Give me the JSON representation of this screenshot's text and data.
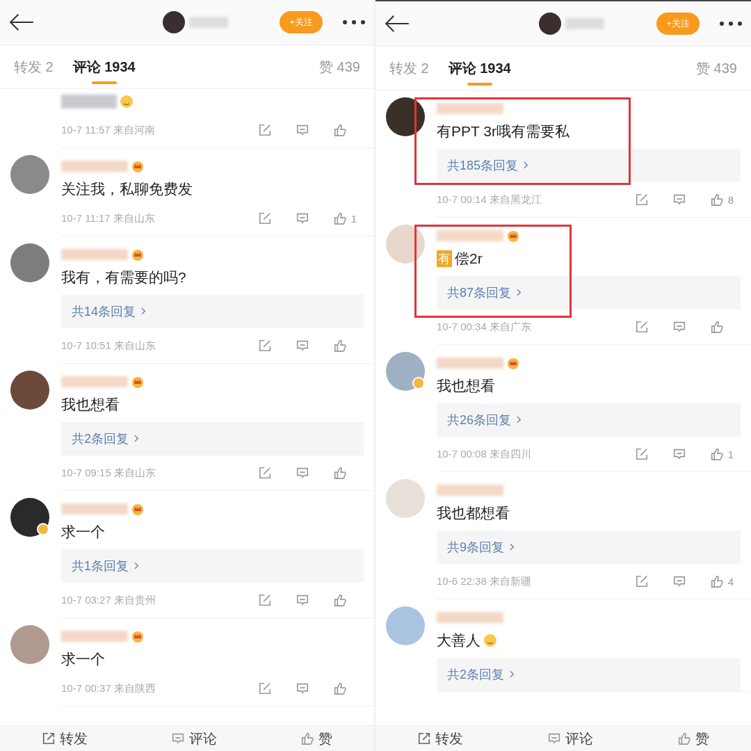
{
  "panels": [
    {
      "header": {
        "follow_label": "+关注"
      },
      "tabs": [
        {
          "label": "转发 2",
          "selected": false
        },
        {
          "label": "评论 1934",
          "selected": true
        }
      ],
      "likes_total": "赞 439",
      "comments": [
        {
          "kind": "partial",
          "emoji": true,
          "time": "10-7 11:57",
          "location": "来自河南"
        },
        {
          "kind": "full",
          "color": "#8a8a8a",
          "crown": true,
          "text": "关注我，私聊免费发",
          "time": "10-7 11:17",
          "location": "来自山东",
          "likes": "1"
        },
        {
          "kind": "full",
          "color": "#7d7d7d",
          "crown": true,
          "text": "我有，有需要的吗?",
          "replies": "共14条回复",
          "time": "10-7 10:51",
          "location": "来自山东"
        },
        {
          "kind": "full",
          "color": "#6b4a3a",
          "crown": true,
          "text": "我也想看",
          "replies": "共2条回复",
          "time": "10-7 09:15",
          "location": "来自山东"
        },
        {
          "kind": "full",
          "color": "#2a2a2a",
          "crown": true,
          "verified": true,
          "text": "求一个",
          "replies": "共1条回复",
          "time": "10-7 03:27",
          "location": "来自贵州"
        },
        {
          "kind": "full",
          "color": "#b09a90",
          "crown": true,
          "text": "求一个",
          "time": "10-7 00:37",
          "location": "来自陕西"
        }
      ],
      "bottom_bar": [
        {
          "kind": "repost",
          "label": "转发"
        },
        {
          "kind": "comment",
          "label": "评论"
        },
        {
          "kind": "like",
          "label": "赞"
        }
      ]
    },
    {
      "header": {
        "follow_label": "+关注"
      },
      "tabs": [
        {
          "label": "转发 2",
          "selected": false
        },
        {
          "label": "评论 1934",
          "selected": true
        }
      ],
      "likes_total": "赞 439",
      "comments": [
        {
          "kind": "full",
          "color": "#3a3028",
          "text": "有PPT 3r哦有需要私",
          "replies": "共185条回复",
          "time": "10-7 00:14",
          "location": "来自黑龙江",
          "likes": "8",
          "highlight": true
        },
        {
          "kind": "full",
          "color": "#e8d8cc",
          "crown": true,
          "tag": "有",
          "text": "偿2r",
          "replies": "共87条回复",
          "time": "10-7 00:34",
          "location": "来自广东",
          "highlight": true
        },
        {
          "kind": "full",
          "color": "#9fb0c4",
          "crown": true,
          "verified": true,
          "text": "我也想看",
          "replies": "共26条回复",
          "time": "10-7 00:08",
          "location": "来自四川",
          "likes": "1"
        },
        {
          "kind": "full",
          "color": "#e6e0d8",
          "text": "我也都想看",
          "replies": "共9条回复",
          "time": "10-6 22:38",
          "location": "来自新疆",
          "likes": "4"
        },
        {
          "kind": "full",
          "color": "#a9c3e0",
          "text": "大善人",
          "emoji": true,
          "replies": "共2条回复"
        }
      ],
      "bottom_bar": [
        {
          "kind": "repost",
          "label": "转发"
        },
        {
          "kind": "comment",
          "label": "评论"
        },
        {
          "kind": "like",
          "label": "赞"
        }
      ]
    }
  ]
}
